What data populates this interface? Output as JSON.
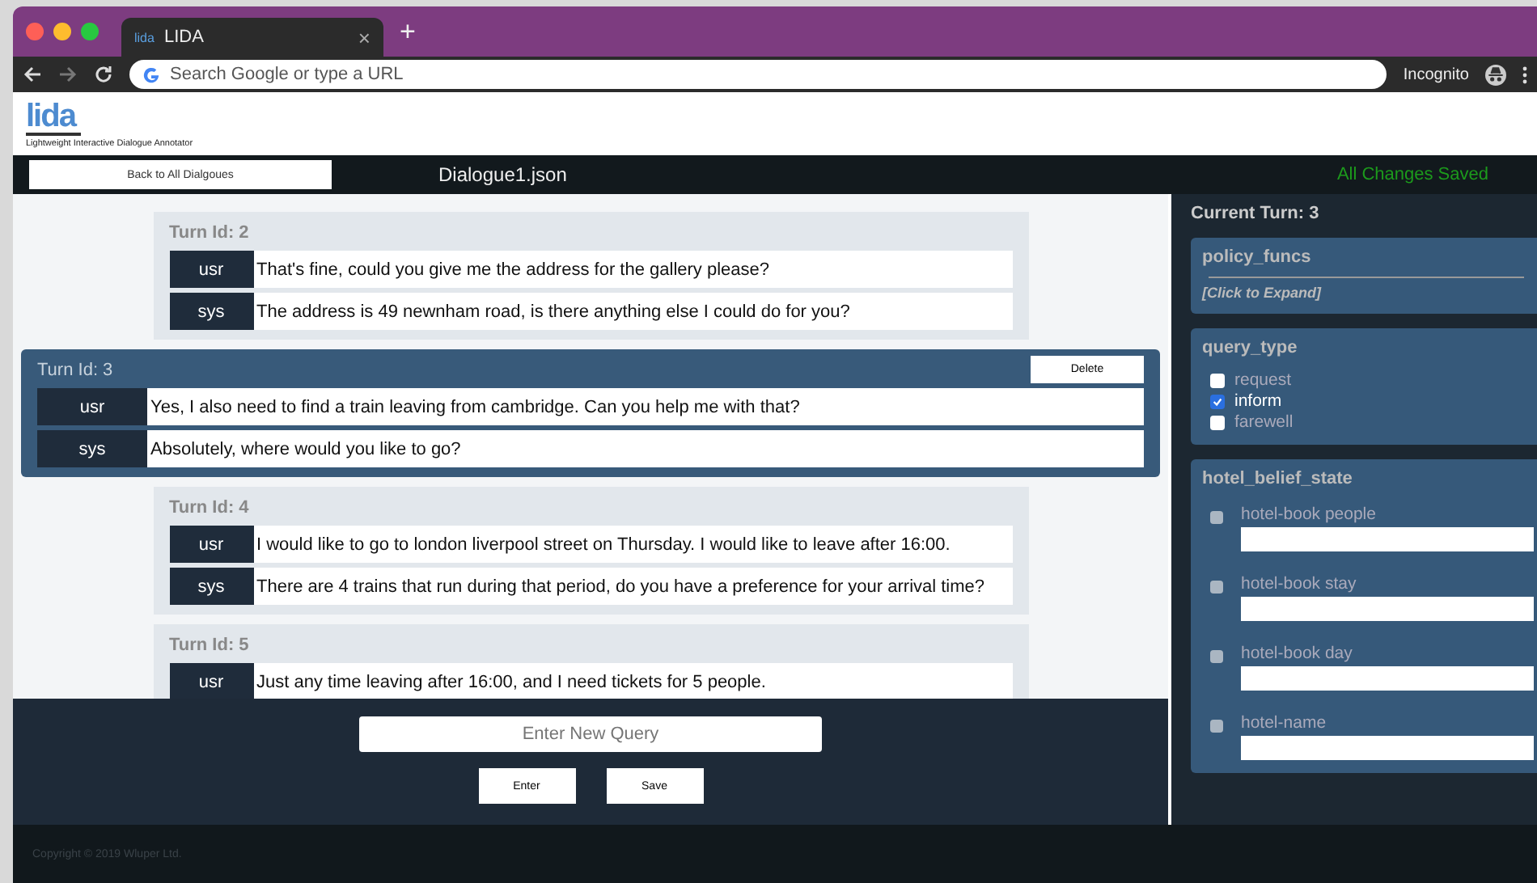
{
  "browser": {
    "tab_icon_text": "lida",
    "tab_title": "LIDA",
    "tab_close": "×",
    "new_tab": "+",
    "address_placeholder": "Search Google or type a URL",
    "profile": "Incognito"
  },
  "header": {
    "logo": "lida",
    "subtitle": "Lightweight Interactive Dialogue Annotator"
  },
  "nav": {
    "back_button": "Back to All Dialgoues",
    "file_name": "Dialogue1.json",
    "status": "All Changes Saved"
  },
  "turns": [
    {
      "turn_id": "Turn Id: 2",
      "selected": false,
      "utterances": [
        {
          "speaker": "usr",
          "text": "That's fine, could you give me the address for the gallery please?"
        },
        {
          "speaker": "sys",
          "text": "The address is 49 newnham road, is there anything else I could do for you?"
        }
      ]
    },
    {
      "turn_id": "Turn Id: 3",
      "selected": true,
      "delete_button": "Delete",
      "utterances": [
        {
          "speaker": "usr",
          "text": "Yes, I also need to find a train leaving from cambridge.  Can you help me with that?"
        },
        {
          "speaker": "sys",
          "text": "Absolutely, where would you like to go?"
        }
      ]
    },
    {
      "turn_id": "Turn Id: 4",
      "selected": false,
      "utterances": [
        {
          "speaker": "usr",
          "text": "I would like to go to london liverpool street on Thursday. I would like to leave after 16:00."
        },
        {
          "speaker": "sys",
          "text": "There are 4 trains that run during that period, do you have a preference for your arrival time?"
        }
      ]
    },
    {
      "turn_id": "Turn Id: 5",
      "selected": false,
      "utterances": [
        {
          "speaker": "usr",
          "text": "Just any time leaving after 16:00, and I need tickets for 5 people."
        }
      ]
    }
  ],
  "query": {
    "placeholder": "Enter New Query",
    "buttons": [
      "Enter",
      "Save"
    ]
  },
  "sidebar": {
    "current_turn": "Current Turn: 3",
    "panels": [
      {
        "kind": "expand",
        "title": "policy_funcs",
        "hint": "[Click to Expand]"
      },
      {
        "kind": "checklist",
        "title": "query_type",
        "options": [
          {
            "label": "request",
            "checked": false
          },
          {
            "label": "inform",
            "checked": true
          },
          {
            "label": "farewell",
            "checked": false
          }
        ]
      },
      {
        "kind": "slots",
        "title": "hotel_belief_state",
        "slots": [
          {
            "label": "hotel-book people",
            "checked": false
          },
          {
            "label": "hotel-book stay",
            "checked": false
          },
          {
            "label": "hotel-book day",
            "checked": false
          },
          {
            "label": "hotel-name",
            "checked": false
          }
        ]
      }
    ]
  },
  "footer": {
    "copyright": "Copyright © 2019 Wluper Ltd."
  }
}
